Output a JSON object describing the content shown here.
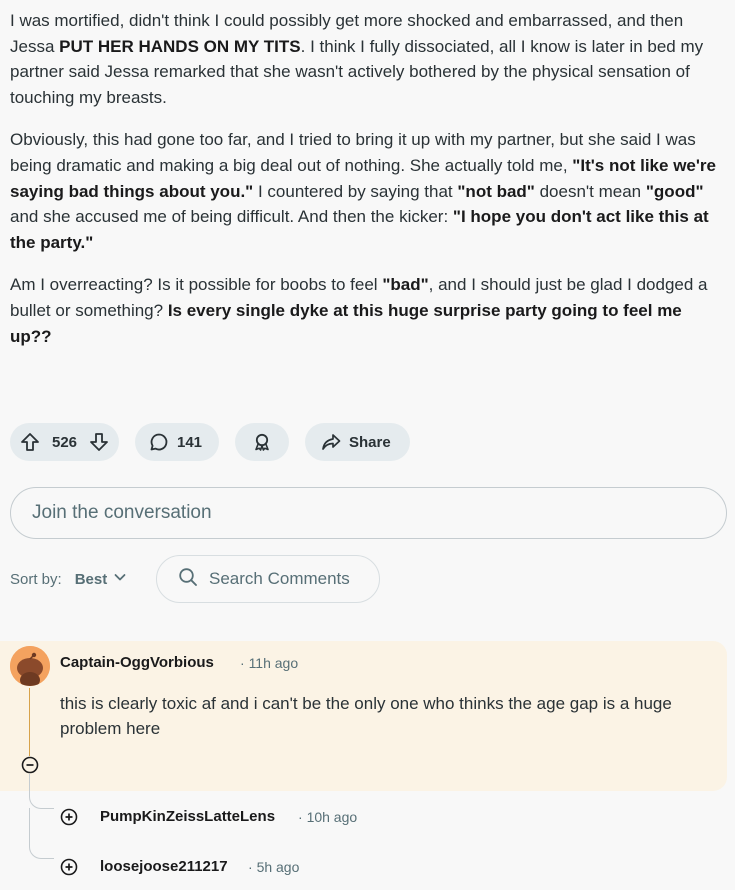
{
  "post": {
    "paragraphs": [
      [
        {
          "t": "I was mortified, didn't think I could possibly get more shocked and embarrassed, and then Jessa "
        },
        {
          "t": "PUT HER HANDS ON MY TITS",
          "b": true
        },
        {
          "t": ". I think I fully dissociated, all I know is later in bed my partner said Jessa remarked that she wasn't actively bothered by the physical sensation of touching my breasts."
        }
      ],
      [
        {
          "t": "Obviously, this had gone too far, and I tried to bring it up with my partner, but she said I was being dramatic and making a big deal out of nothing. She actually told me, "
        },
        {
          "t": "\"It's not like we're saying bad things about you.\"",
          "b": true
        },
        {
          "t": " I countered by saying that "
        },
        {
          "t": "\"not bad\"",
          "b": true
        },
        {
          "t": " doesn't mean "
        },
        {
          "t": "\"good\"",
          "b": true
        },
        {
          "t": " and she accused me of being difficult. And then the kicker: "
        },
        {
          "t": "\"I hope you don't act like this at the party.\"",
          "b": true
        }
      ],
      [
        {
          "t": "Am I overreacting? Is it possible for boobs to feel "
        },
        {
          "t": "\"bad\"",
          "b": true
        },
        {
          "t": ", and I should just be glad I dodged a bullet or something? "
        },
        {
          "t": "Is every single dyke at this huge surprise party going to feel me up??",
          "b": true
        }
      ]
    ]
  },
  "actions": {
    "votes": "526",
    "comments": "141",
    "share_label": "Share"
  },
  "join_placeholder": "Join the conversation",
  "sort": {
    "label": "Sort by:",
    "value": "Best",
    "search_placeholder": "Search Comments"
  },
  "comment": {
    "author": "Captain-OggVorbious",
    "time": "11h ago",
    "text": "this is clearly toxic af and i can't be the only one who thinks the age gap is a huge problem here"
  },
  "replies": [
    {
      "author": "PumpKinZeissLatteLens",
      "time": "10h ago"
    },
    {
      "author": "loosejoose211217",
      "time": "5h ago"
    }
  ],
  "colors": {
    "highlight_bg": "#fbf3e5",
    "thread_line": "#d7a24a",
    "avatar_bg": "#f4a25f",
    "pill_bg": "#e5ebee"
  }
}
